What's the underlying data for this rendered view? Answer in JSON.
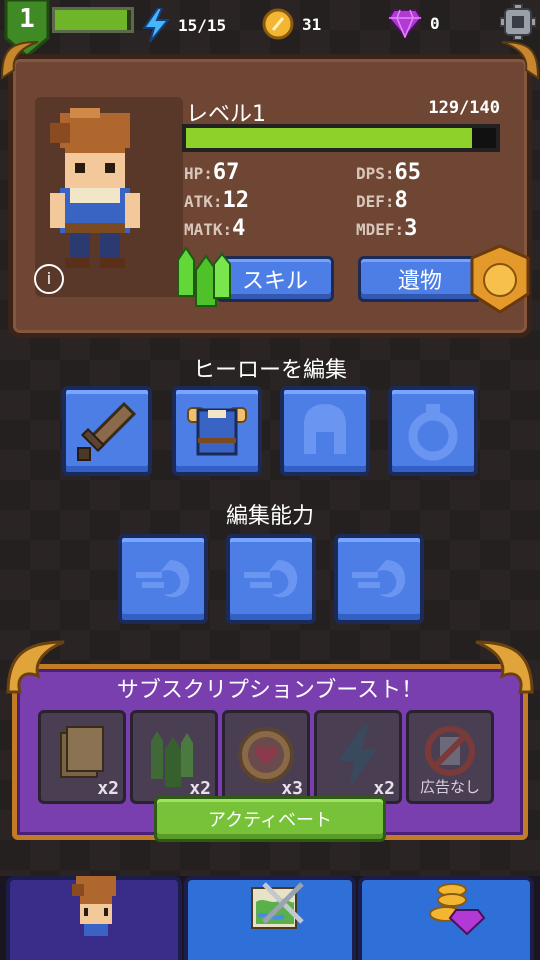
{
  "top": {
    "player_level": "1",
    "energy": "15/15",
    "gold": "31",
    "gems": "0",
    "xp_fraction": 0.95
  },
  "hero": {
    "level_label": "レベル1",
    "hp_text": "129/140",
    "hp_fraction": 0.9214,
    "stats": {
      "hp_key": "HP:",
      "hp_val": "67",
      "dps_key": "DPS:",
      "dps_val": "65",
      "atk_key": "ATK:",
      "atk_val": "12",
      "def_key": "DEF:",
      "def_val": "8",
      "matk_key": "MATK:",
      "matk_val": "4",
      "mdef_key": "MDEF:",
      "mdef_val": "3"
    },
    "skill_button": "スキル",
    "relic_button": "遺物",
    "info_glyph": "i"
  },
  "edit_hero": {
    "title": "ヒーローを編集",
    "slots": [
      "sword",
      "armor",
      "helmet-empty",
      "ring-empty"
    ]
  },
  "edit_ability": {
    "title": "編集能力"
  },
  "subscription": {
    "title": "サブスクリプションブースト！",
    "boosts": [
      {
        "icon": "book-icon",
        "label": "x2"
      },
      {
        "icon": "crystal-icon",
        "label": "x2"
      },
      {
        "icon": "heart-orb-icon",
        "label": "x3"
      },
      {
        "icon": "lightning-icon",
        "label": "x2"
      },
      {
        "icon": "no-ads-icon",
        "label": "広告なし"
      }
    ],
    "activate_button": "アクティベート"
  },
  "colors": {
    "accent_blue": "#4c7ee6",
    "accent_green": "#78c23a",
    "panel_brown": "#6e4633",
    "sub_purple": "#7a3fae"
  }
}
